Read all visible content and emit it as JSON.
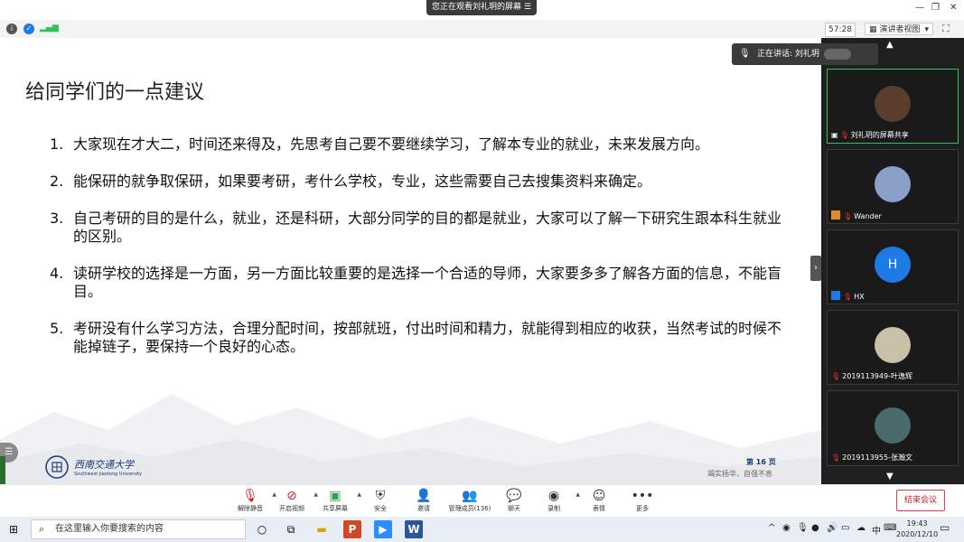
{
  "share_banner": {
    "text": "您正在观看刘礼玥的屏幕",
    "menu_icon": "menu-icon"
  },
  "window_controls": {
    "minimize": "—",
    "restore": "❐",
    "close": "✕"
  },
  "security_bar": {
    "timer": "57:28",
    "view_label": "演讲者视图",
    "view_caret": "▾",
    "fullscreen": "⛶"
  },
  "slide": {
    "title": "给同学们的一点建议",
    "points": [
      {
        "num": "1.",
        "text": "大家现在才大二，时间还来得及，先思考自己要不要继续学习，了解本专业的就业，未来发展方向。"
      },
      {
        "num": "2.",
        "text": "能保研的就争取保研，如果要考研，考什么学校，专业，这些需要自己去搜集资料来确定。"
      },
      {
        "num": "3.",
        "text": "自己考研的目的是什么，就业，还是科研，大部分同学的目的都是就业，大家可以了解一下研究生跟本科生就业的区别。"
      },
      {
        "num": "4.",
        "text": "读研学校的选择是一方面，另一方面比较重要的是选择一个合适的导师，大家要多多了解各方面的信息，不能盲目。"
      },
      {
        "num": "5.",
        "text": "考研没有什么学习方法，合理分配时间，按部就班，付出时间和精力，就能得到相应的收获，当然考试的时候不能掉链子，要保持一个良好的心态。"
      }
    ],
    "logo_text": "西南交通大学",
    "logo_sub": "Southwest Jiaotong University",
    "page_num": "第 16 页",
    "motto": "竭实扬华，自强不息"
  },
  "speaking": {
    "label": "正在讲话: 刘礼玥"
  },
  "participants": [
    {
      "name": "刘礼玥的屏幕共享",
      "avatar_color": "#5a3d2b",
      "initial": "",
      "active": true
    },
    {
      "name": "Wander",
      "avatar_color": "#8aa0c8",
      "initial": "",
      "active": false
    },
    {
      "name": "HX",
      "avatar_color": "#1e7be6",
      "initial": "H",
      "active": false
    },
    {
      "name": "2019113949-叶逸辉",
      "avatar_color": "#c9c0a8",
      "initial": "",
      "active": false
    },
    {
      "name": "2019113955-张瀚文",
      "avatar_color": "#4a6b6b",
      "initial": "",
      "active": false
    }
  ],
  "toolbar": {
    "mute": "解除静音",
    "video": "开启视频",
    "share": "共享屏幕",
    "security": "安全",
    "invite": "邀请",
    "manage": "管理成员(136)",
    "chat": "聊天",
    "record": "录制",
    "reactions": "表情",
    "more": "更多",
    "end": "结束会议"
  },
  "taskbar": {
    "search_placeholder": "在这里输入你要搜索的内容",
    "ime": "中",
    "time": "19:43",
    "date": "2020/12/10"
  }
}
